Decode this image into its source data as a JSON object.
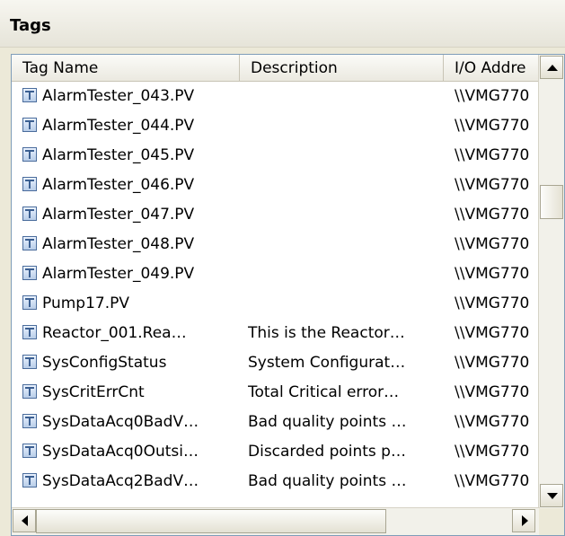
{
  "panel": {
    "title": "Tags"
  },
  "columns": [
    "Tag Name",
    "Description",
    "I/O Addre"
  ],
  "rows": [
    {
      "name": "AlarmTester_043.PV",
      "description": "",
      "io": "\\\\VMG770"
    },
    {
      "name": "AlarmTester_044.PV",
      "description": "",
      "io": "\\\\VMG770"
    },
    {
      "name": "AlarmTester_045.PV",
      "description": "",
      "io": "\\\\VMG770"
    },
    {
      "name": "AlarmTester_046.PV",
      "description": "",
      "io": "\\\\VMG770"
    },
    {
      "name": "AlarmTester_047.PV",
      "description": "",
      "io": "\\\\VMG770"
    },
    {
      "name": "AlarmTester_048.PV",
      "description": "",
      "io": "\\\\VMG770"
    },
    {
      "name": "AlarmTester_049.PV",
      "description": "",
      "io": "\\\\VMG770"
    },
    {
      "name": "Pump17.PV",
      "description": "",
      "io": "\\\\VMG770"
    },
    {
      "name": "Reactor_001.Rea…",
      "description": "This is the Reactor…",
      "io": "\\\\VMG770"
    },
    {
      "name": "SysConfigStatus",
      "description": "System Configurat…",
      "io": "\\\\VMG770"
    },
    {
      "name": "SysCritErrCnt",
      "description": "Total Critical error…",
      "io": "\\\\VMG770"
    },
    {
      "name": "SysDataAcq0BadV…",
      "description": "Bad quality points …",
      "io": "\\\\VMG770"
    },
    {
      "name": "SysDataAcq0Outsi…",
      "description": "Discarded points p…",
      "io": "\\\\VMG770"
    },
    {
      "name": "SysDataAcq2BadV…",
      "description": "Bad quality points …",
      "io": "\\\\VMG770"
    }
  ],
  "icons": {
    "row_icon": "tag-icon"
  }
}
